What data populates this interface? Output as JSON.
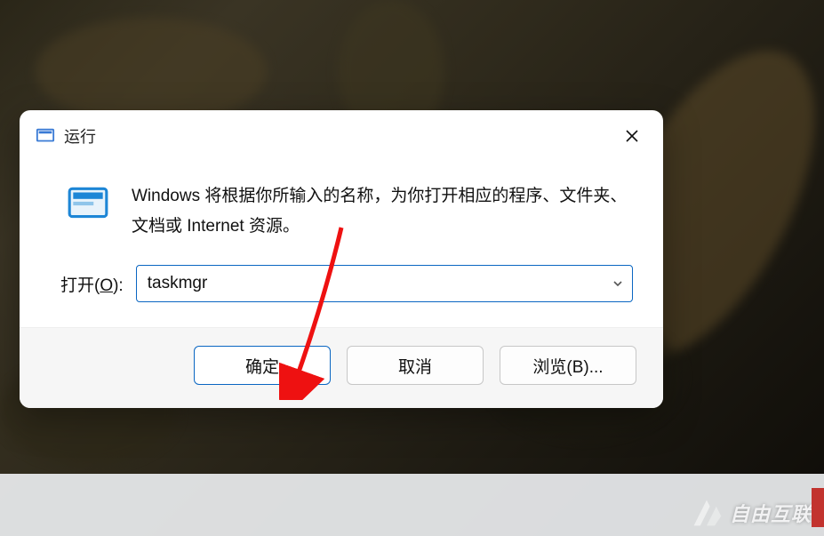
{
  "dialog": {
    "title": "运行",
    "description": "Windows 将根据你所输入的名称，为你打开相应的程序、文件夹、文档或 Internet 资源。",
    "open_label_prefix": "打开(",
    "open_label_hotkey": "O",
    "open_label_suffix": "):",
    "input_value": "taskmgr",
    "ok_label": "确定",
    "cancel_label": "取消",
    "browse_label": "浏览(B)..."
  },
  "watermark": {
    "text": "自由互联"
  }
}
